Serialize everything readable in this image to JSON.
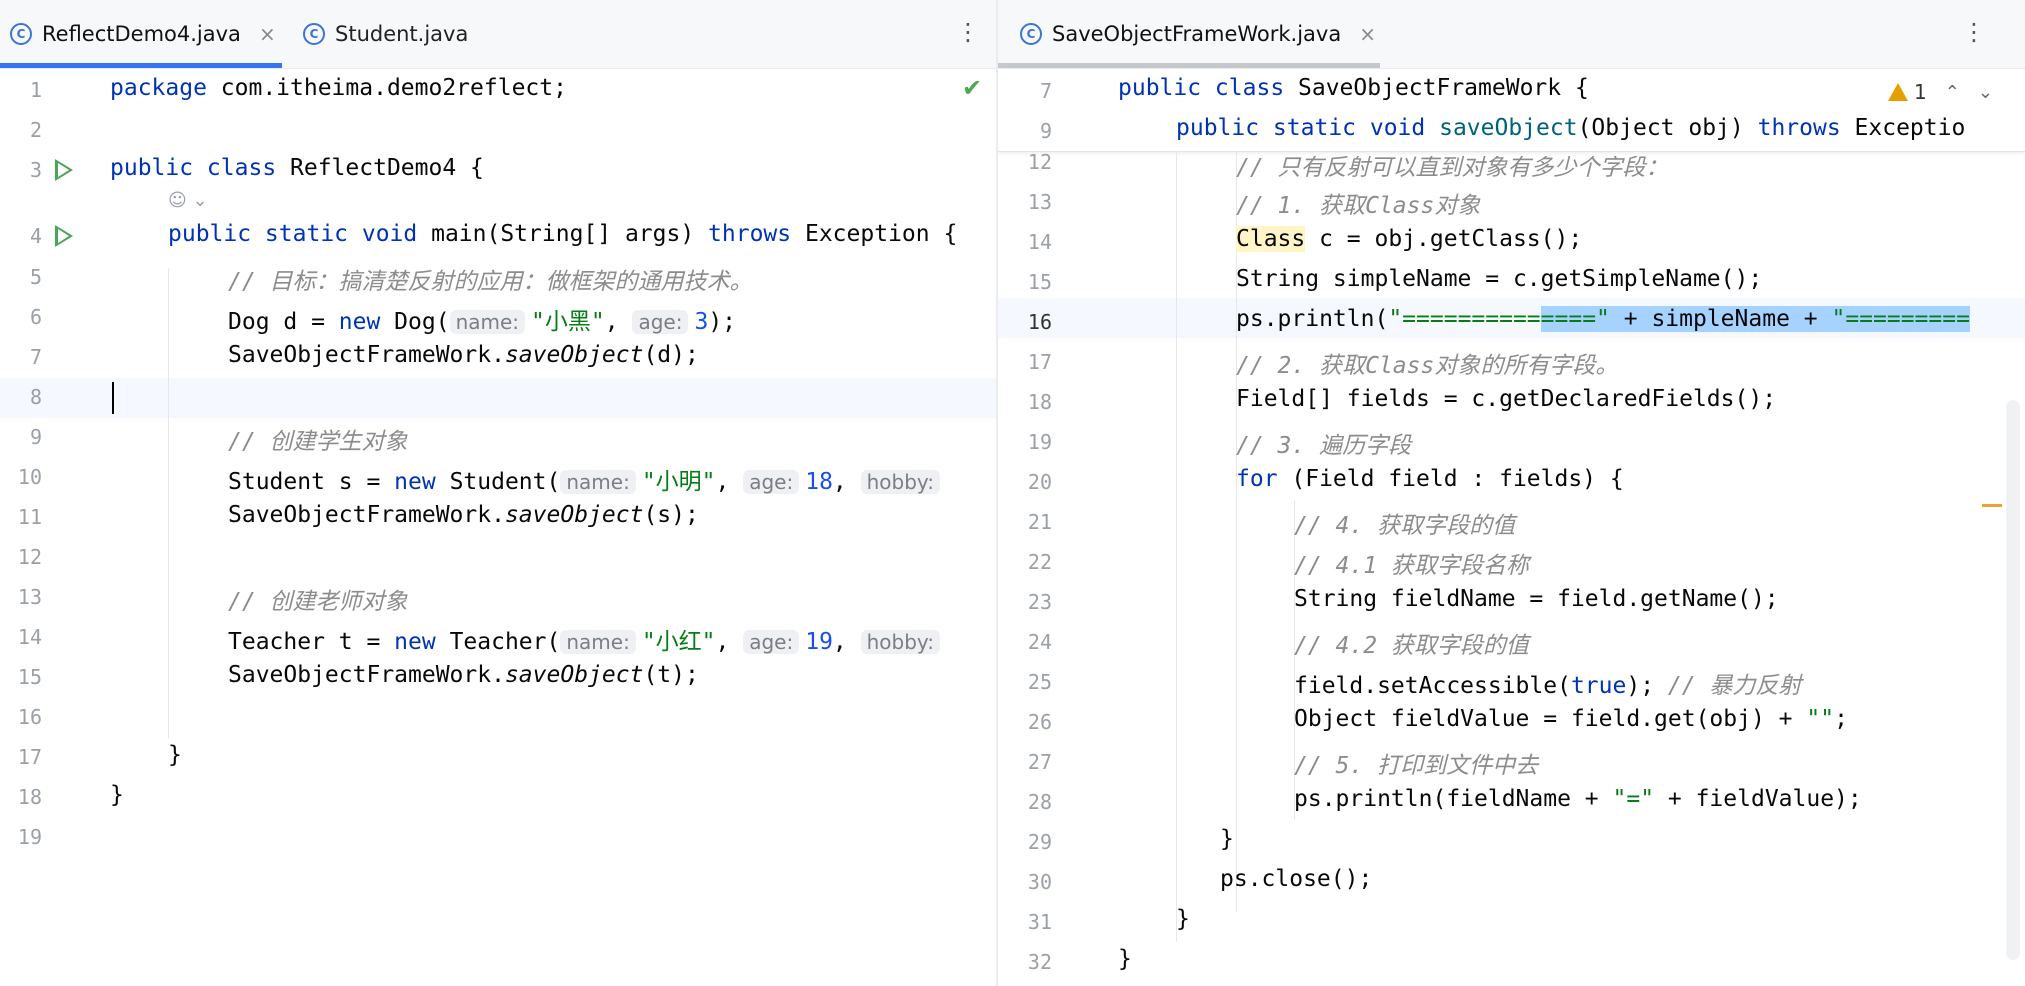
{
  "left": {
    "tabs": [
      {
        "label": "ReflectDemo4.java",
        "icon": "java-class-icon",
        "active": true
      },
      {
        "label": "Student.java",
        "icon": "java-class-icon",
        "active": false
      }
    ],
    "kebab": "⋮",
    "line_numbers": [
      "1",
      "2",
      "3",
      "4",
      "5",
      "6",
      "7",
      "8",
      "9",
      "10",
      "11",
      "12",
      "13",
      "14",
      "15",
      "16",
      "17",
      "18",
      "19"
    ],
    "author_hint": "☺ ⌄",
    "code": {
      "l1_kw": "package",
      "l1_rest": " com.itheima.demo2reflect;",
      "l3_kw": "public class",
      "l3_rest": " ReflectDemo4 {",
      "l4_kw": "public static void",
      "l4_mid": " main(String[] args) ",
      "l4_kw2": "throws",
      "l4_rest": " Exception {",
      "l5": "// 目标：搞清楚反射的应用：做框架的通用技术。",
      "l6_a": "Dog d = ",
      "l6_kw": "new",
      "l6_b": " Dog(",
      "l6_hint1": "name:",
      "l6_str": "\"小黑\"",
      "l6_c": ", ",
      "l6_hint2": "age:",
      "l6_num": "3",
      "l6_d": ");",
      "l7_a": "SaveObjectFrameWork.",
      "l7_it": "saveObject",
      "l7_b": "(d);",
      "l9": "// 创建学生对象",
      "l10_a": "Student s = ",
      "l10_kw": "new",
      "l10_b": " Student(",
      "l10_hint1": "name:",
      "l10_str": "\"小明\"",
      "l10_c": ", ",
      "l10_hint2": "age:",
      "l10_num": "18",
      "l10_d": ", ",
      "l10_hint3": "hobby:",
      "l11_a": "SaveObjectFrameWork.",
      "l11_it": "saveObject",
      "l11_b": "(s);",
      "l13": "// 创建老师对象",
      "l14_a": "Teacher t = ",
      "l14_kw": "new",
      "l14_b": " Teacher(",
      "l14_hint1": "name:",
      "l14_str": "\"小红\"",
      "l14_c": ", ",
      "l14_hint2": "age:",
      "l14_num": "19",
      "l14_d": ", ",
      "l14_hint3": "hobby:",
      "l15_a": "SaveObjectFrameWork.",
      "l15_it": "saveObject",
      "l15_b": "(t);",
      "l17": "}",
      "l18": "}"
    }
  },
  "right": {
    "tabs": [
      {
        "label": "SaveObjectFrameWork.java",
        "icon": "java-class-icon",
        "active": true
      }
    ],
    "kebab": "⋮",
    "warnings": {
      "count": "1",
      "up": "⌃",
      "down": "⌄"
    },
    "sticky": {
      "n7": "7",
      "s7_kw": "public class",
      "s7_rest": " SaveObjectFrameWork {",
      "n9": "9",
      "s9_kw": "public static void",
      "s9_fn": " saveObject",
      "s9_mid": "(Object obj) ",
      "s9_kw2": "throws",
      "s9_rest": " Exceptio"
    },
    "line_numbers": [
      "12",
      "13",
      "14",
      "15",
      "16",
      "17",
      "18",
      "19",
      "20",
      "21",
      "22",
      "23",
      "24",
      "25",
      "26",
      "27",
      "28",
      "29",
      "30",
      "31",
      "32"
    ],
    "code": {
      "r12": "// 只有反射可以直到对象有多少个字段：",
      "r13": "// 1. 获取Class对象",
      "r14_cls": "Class",
      "r14_rest": " c = obj.getClass();",
      "r15": "String simpleName = c.getSimpleName();",
      "r16_a": "ps.println(",
      "r16_str1": "\"==========",
      "r16_sel_str": "====\"",
      "r16_sel_rest": " + simpleName + ",
      "r16_sel_str2": "\"=========",
      "r17": "// 2. 获取Class对象的所有字段。",
      "r18": "Field[] fields = c.getDeclaredFields();",
      "r19": "// 3. 遍历字段",
      "r20_kw": "for",
      "r20_rest": " (Field field : fields) {",
      "r21": "// 4. 获取字段的值",
      "r22": "// 4.1 获取字段名称",
      "r23": "String fieldName = field.getName();",
      "r24": "// 4.2 获取字段的值",
      "r25_a": "field.setAccessible(",
      "r25_kw": "true",
      "r25_b": "); ",
      "r25_cm": "// 暴力反射",
      "r26_a": "Object fieldValue = field.get(obj) + ",
      "r26_str": "\"\"",
      "r26_b": ";",
      "r27": "// 5. 打印到文件中去",
      "r28_a": "ps.println(fieldName + ",
      "r28_str": "\"=\"",
      "r28_b": " + fieldValue);",
      "r29": "}",
      "r30": "ps.close();",
      "r31": "}",
      "r32": "}"
    }
  }
}
